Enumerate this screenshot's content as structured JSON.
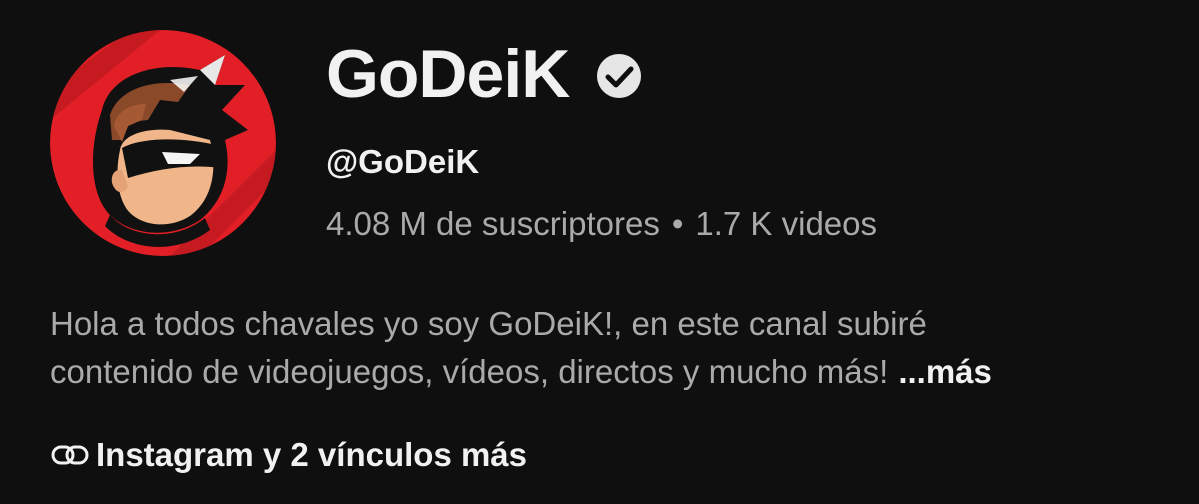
{
  "channel": {
    "name": "GoDeiK",
    "verified": true,
    "handle": "@GoDeiK",
    "subscribers": "4.08 M de suscriptores",
    "separator": "•",
    "videos": "1.7 K videos",
    "avatar_icon": "cartoon-ninja-avatar"
  },
  "description": {
    "line1": "Hola a todos chavales yo soy GoDeiK!, en este canal subiré",
    "line2": "contenido de videojuegos, vídeos, directos y mucho más!",
    "more_label": "...más"
  },
  "links": {
    "icon": "link-icon",
    "label": "Instagram y 2 vínculos más"
  },
  "colors": {
    "background": "#0f0f0f",
    "primary_text": "#f1f1f1",
    "secondary_text": "#aaaaaa",
    "avatar_red": "#e21f26"
  }
}
